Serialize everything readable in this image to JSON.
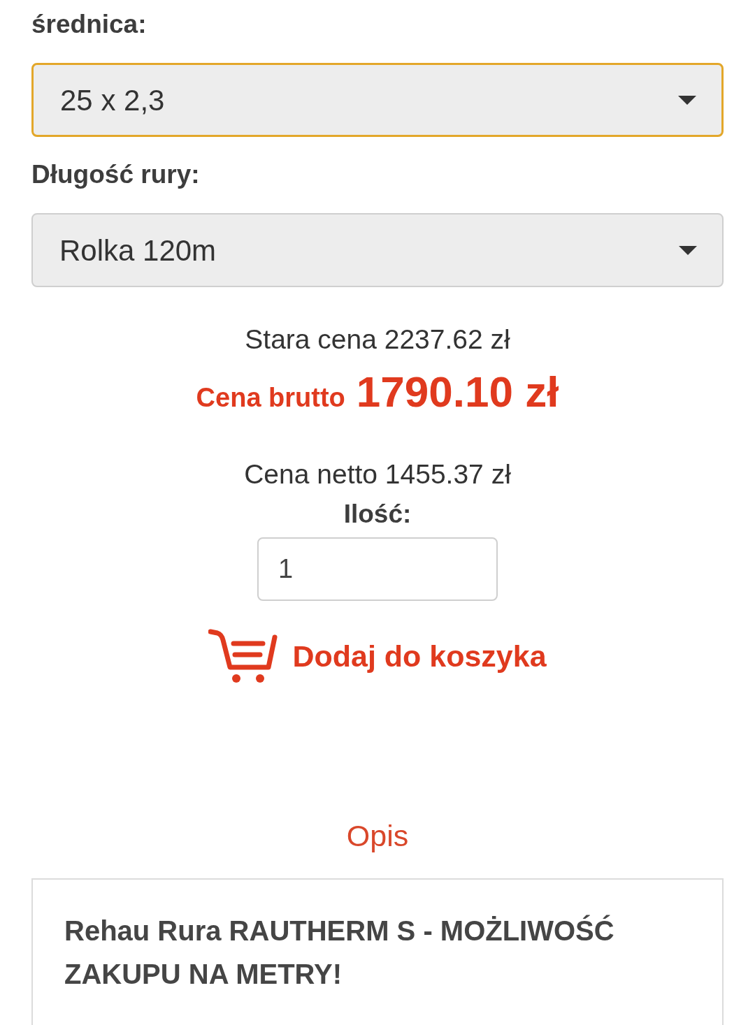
{
  "fields": [
    {
      "label": "średnica:",
      "value": "25 x 2,3",
      "focused": true
    },
    {
      "label": "Długość rury:",
      "value": "Rolka 120m",
      "focused": false
    }
  ],
  "price": {
    "old": "Stara cena 2237.62 zł",
    "gross_label": "Cena brutto",
    "gross_value": "1790.10 zł",
    "net": "Cena netto 1455.37 zł"
  },
  "quantity": {
    "label": "Ilość:",
    "value": "1"
  },
  "add_to_cart": {
    "label": "Dodaj do koszyka"
  },
  "description": {
    "heading": "Opis",
    "text": "Rehau Rura RAUTHERM S - MOŻLIWOŚĆ ZAKUPU NA METRY!"
  }
}
